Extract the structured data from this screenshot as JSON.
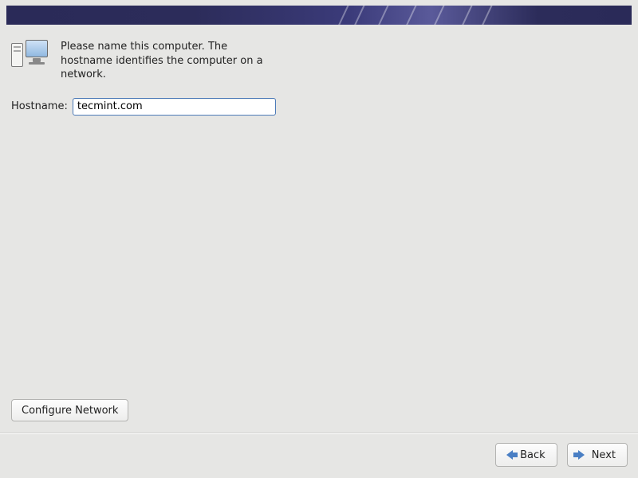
{
  "intro_text": "Please name this computer.  The hostname identifies the computer on a network.",
  "hostname": {
    "label": "Hostname:",
    "value": "tecmint.com"
  },
  "buttons": {
    "configure_network": "Configure Network",
    "back": "Back",
    "next": "Next"
  }
}
